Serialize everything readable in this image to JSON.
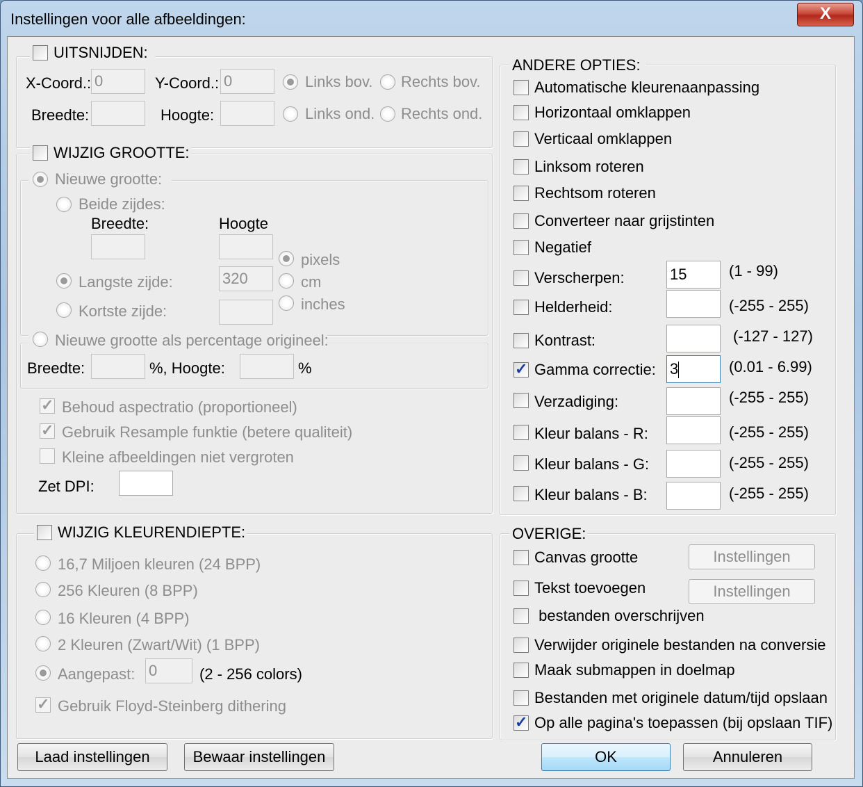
{
  "window": {
    "title": "Instellingen voor alle afbeeldingen:",
    "close_label": "X"
  },
  "crop": {
    "title": "UITSNIJDEN:",
    "x_label": "X-Coord.:",
    "x_value": "0",
    "y_label": "Y-Coord.:",
    "y_value": "0",
    "width_label": "Breedte:",
    "height_label": "Hoogte:",
    "top_left": "Links bov.",
    "top_right": "Rechts bov.",
    "bottom_left": "Links ond.",
    "bottom_right": "Rechts ond."
  },
  "resize": {
    "title": "WIJZIG GROOTTE:",
    "new_size": "Nieuwe grootte:",
    "both_sides": "Beide zijdes:",
    "width_label": "Breedte:",
    "height_label": "Hoogte",
    "longest_side": "Langste zijde:",
    "longest_value": "320",
    "shortest_side": "Kortste zijde:",
    "unit_pixels": "pixels",
    "unit_cm": "cm",
    "unit_inches": "inches",
    "percentage": "Nieuwe grootte als percentage origineel:",
    "pct_width_label": "Breedte:",
    "pct_height_label": "%, Hoogte:",
    "pct_suffix": "%",
    "keep_aspect": "Behoud aspectratio (proportioneel)",
    "resample": "Gebruik Resample funktie (betere qualiteit)",
    "no_enlarge": "Kleine afbeeldingen niet vergroten",
    "dpi_label": "Zet DPI:"
  },
  "color_depth": {
    "title": "WIJZIG KLEURENDIEPTE:",
    "opt_24": "16,7 Miljoen kleuren (24 BPP)",
    "opt_8": "256 Kleuren (8 BPP)",
    "opt_4": "16 Kleuren (4 BPP)",
    "opt_1": "2 Kleuren (Zwart/Wit) (1 BPP)",
    "custom": "Aangepast:",
    "custom_value": "0",
    "custom_range": "(2 - 256 colors)",
    "dithering": "Gebruik Floyd-Steinberg dithering"
  },
  "other_options": {
    "title": "ANDERE OPTIES:",
    "auto_color": "Automatische kleurenaanpassing",
    "flip_h": "Horizontaal omklappen",
    "flip_v": "Verticaal omklappen",
    "rotate_left": "Linksom roteren",
    "rotate_right": "Rechtsom roteren",
    "grayscale": "Converteer naar grijstinten",
    "negative": "Negatief",
    "sharpen": "Verscherpen:",
    "sharpen_value": "15",
    "sharpen_range": "(1  -  99)",
    "brightness": "Helderheid:",
    "brightness_range": "(-255  -  255)",
    "contrast": "Kontrast:",
    "contrast_range": "(-127  -  127)",
    "gamma": "Gamma correctie:",
    "gamma_value": "3",
    "gamma_range": "(0.01  -  6.99)",
    "saturation": "Verzadiging:",
    "saturation_range": "(-255  -  255)",
    "balance_r": "Kleur balans - R:",
    "balance_r_range": "(-255  -  255)",
    "balance_g": "Kleur balans - G:",
    "balance_g_range": "(-255  -  255)",
    "balance_b": "Kleur balans - B:",
    "balance_b_range": "(-255  -  255)"
  },
  "misc": {
    "title": "OVERIGE:",
    "canvas": "Canvas grootte",
    "text": "Tekst toevoegen",
    "settings_label": "Instellingen",
    "overwrite": " bestanden overschrijven",
    "delete_originals": "Verwijder originele bestanden na conversie",
    "subfolders": "Maak submappen in doelmap",
    "keep_date": "Bestanden met originele datum/tijd opslaan",
    "all_pages": "Op alle pagina's toepassen (bij opslaan TIF)"
  },
  "buttons": {
    "load": "Laad instellingen",
    "save": "Bewaar instellingen",
    "ok": "OK",
    "cancel": "Annuleren"
  }
}
